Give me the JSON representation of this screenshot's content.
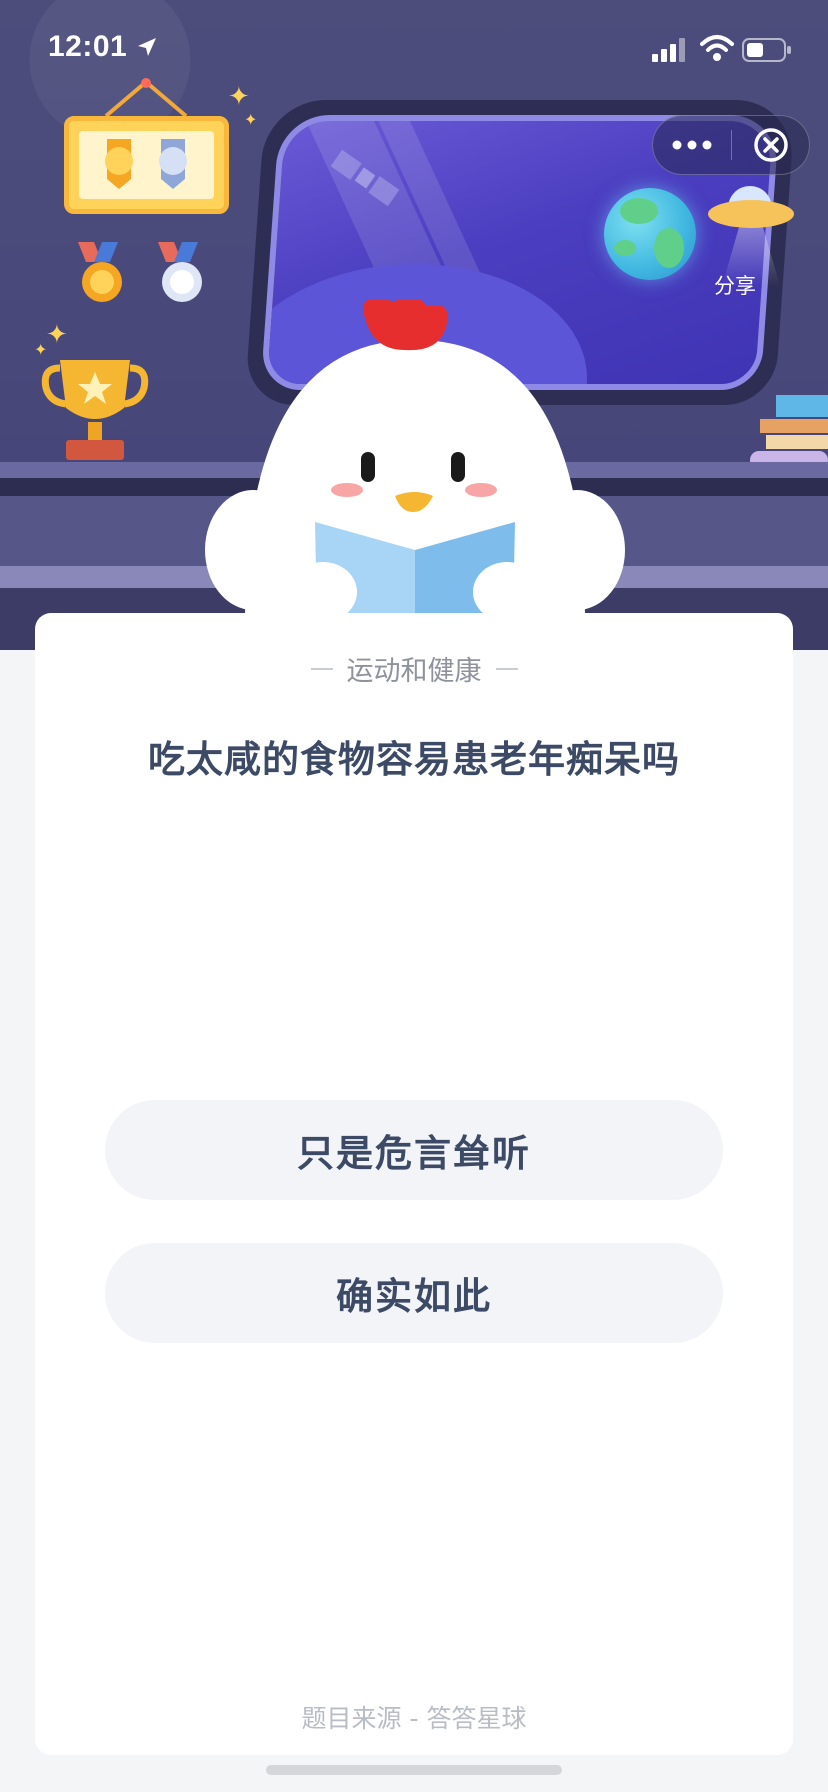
{
  "status_bar": {
    "time": "12:01"
  },
  "icons": {
    "location": "location-arrow-icon",
    "signal": "cellular-signal-icon",
    "wifi": "wifi-icon",
    "battery": "battery-icon",
    "more": "more-dots-icon",
    "close": "close-circle-icon",
    "share": "ufo-share-icon"
  },
  "header": {
    "share_label": "分享"
  },
  "quiz": {
    "category": "运动和健康",
    "question": "吃太咸的食物容易患老年痴呆吗",
    "options": [
      {
        "label": "只是危言耸听"
      },
      {
        "label": "确实如此"
      }
    ],
    "source": "题目来源 - 答答星球"
  },
  "colors": {
    "scene_bg": "#4a4a78",
    "text_primary": "#3d4a66",
    "text_muted": "#8d929c",
    "option_bg": "#f3f4f7",
    "card_bg": "#ffffff",
    "page_bg": "#f4f5f7"
  }
}
